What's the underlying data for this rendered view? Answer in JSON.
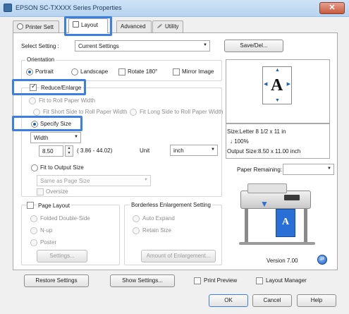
{
  "window": {
    "title": "EPSON SC-TXXXX Series Properties",
    "close_label": "✕"
  },
  "tabs": [
    {
      "label": "Printer Sett"
    },
    {
      "label": "Layout"
    },
    {
      "label": "Advanced"
    },
    {
      "label": "Utility"
    }
  ],
  "select_setting": {
    "label": "Select Setting :",
    "value": "Current Settings",
    "save_button": "Save/Del..."
  },
  "orientation": {
    "title": "Orientation",
    "portrait": "Portrait",
    "landscape": "Landscape",
    "rotate": "Rotate 180°",
    "mirror": "Mirror Image"
  },
  "reduce_enlarge": {
    "label": "Reduce/Enlarge",
    "fit_roll_width": "Fit to Roll Paper Width",
    "fit_short_side": "Fit Short Side to Roll Paper Width",
    "fit_long_side": "Fit Long Side to Roll Paper Width",
    "specify_size": "Specify Size",
    "dimension_select": "Width",
    "size_value": "8.50",
    "size_range": "( 3.86 - 44.02)",
    "unit_label": "Unit",
    "unit_value": "inch",
    "fit_output": "Fit to Output Size",
    "output_select": "Same as Page Size",
    "oversize": "Oversize"
  },
  "page_layout": {
    "label": "Page Layout",
    "folded": "Folded Double-Side",
    "nup": "N-up",
    "poster": "Poster",
    "settings_button": "Settings..."
  },
  "borderless": {
    "title": "Borderless Enlargement Setting",
    "auto_expand": "Auto Expand",
    "retain_size": "Retain Size",
    "amount_button": "Amount of Enlargement..."
  },
  "preview": {
    "paper_letter": "A",
    "size_info": "Size:Letter 8 1/2 x 11 in",
    "scale_info": "↓ 100%",
    "output_info": "Output Size:8.50 x 11.00 inch",
    "paper_remaining_label": "Paper Remaining:",
    "version": "Version 7.00"
  },
  "bottom": {
    "restore": "Restore Settings",
    "show_settings": "Show Settings...",
    "print_preview": "Print Preview",
    "layout_manager": "Layout Manager",
    "ok": "OK",
    "cancel": "Cancel",
    "help": "Help"
  },
  "colors": {
    "accent": "#3d7fe0",
    "titlebar": "#b7d3ef",
    "close": "#c75a3f"
  }
}
